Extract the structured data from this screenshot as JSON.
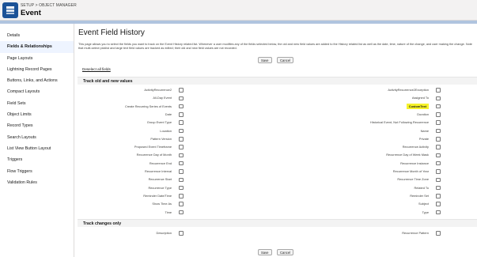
{
  "header": {
    "breadcrumb": "SETUP > OBJECT MANAGER",
    "title": "Event"
  },
  "sidebar": {
    "items": [
      {
        "label": "Details",
        "active": false
      },
      {
        "label": "Fields & Relationships",
        "active": true
      },
      {
        "label": "Page Layouts",
        "active": false
      },
      {
        "label": "Lightning Record Pages",
        "active": false
      },
      {
        "label": "Buttons, Links, and Actions",
        "active": false
      },
      {
        "label": "Compact Layouts",
        "active": false
      },
      {
        "label": "Field Sets",
        "active": false
      },
      {
        "label": "Object Limits",
        "active": false
      },
      {
        "label": "Record Types",
        "active": false
      },
      {
        "label": "Search Layouts",
        "active": false
      },
      {
        "label": "List View Button Layout",
        "active": false
      },
      {
        "label": "Triggers",
        "active": false
      },
      {
        "label": "Flow Triggers",
        "active": false
      },
      {
        "label": "Validation Rules",
        "active": false
      }
    ]
  },
  "main": {
    "title": "Event Field History",
    "intro": "This page allows you to select the fields you want to track on the Event History related list. Whenever a user modifies any of the fields selected below, the old and new field values are added to the History related list as well as the date, time, nature of the change, and user making the change. Note that multi-select picklist and large text field values are tracked as edited; their old and new field values are not recorded.",
    "save_label": "Save",
    "cancel_label": "Cancel",
    "deselect_label": "Deselect all fields",
    "section1_title": "Track old and new values",
    "section2_title": "Track changes only",
    "section1_left": [
      "ActivityRecurrence2",
      "All-Day Event",
      "Create Recurring Series of Events",
      "Date",
      "Group Event Type",
      "Location",
      "Pattern Version",
      "Proposed Event Timeframe",
      "Recurrence Day of Month",
      "Recurrence End",
      "Recurrence Interval",
      "Recurrence Start",
      "Recurrence Type",
      "Reminder Date/Time",
      "Show Time As",
      "Time"
    ],
    "section1_right": [
      "ActivityRecurrence2Exception",
      "Assigned To",
      "CustomText",
      "Duration",
      "Historical Event, Not Following Recurrence",
      "Name",
      "Private",
      "Recurrence Activity",
      "Recurrence Day of Week Mask",
      "Recurrence Instance",
      "Recurrence Month of Year",
      "Recurrence Time Zone",
      "Related To",
      "Reminder Set",
      "Subject",
      "Type"
    ],
    "section2_left": [
      "Description"
    ],
    "section2_right": [
      "Recurrence Pattern"
    ],
    "highlight_color": "#f6f22a"
  }
}
